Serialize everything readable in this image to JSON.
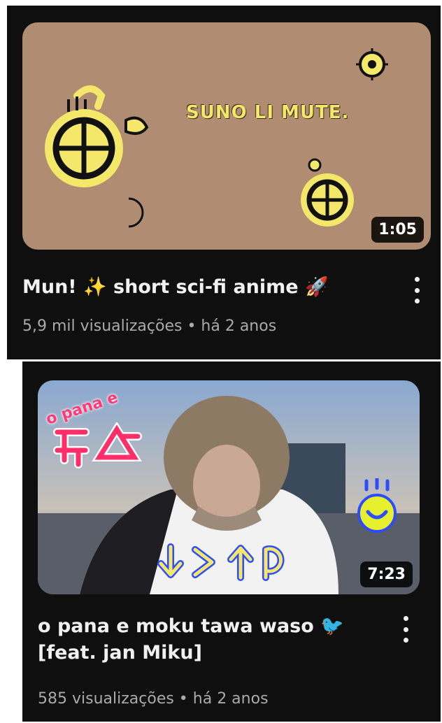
{
  "videos": [
    {
      "title": "Mun! ✨ short sci-fi anime 🚀",
      "meta": "5,9 mil visualizações • há 2 anos",
      "duration": "1:05",
      "thumb_text": "SUNO LI MUTE.",
      "menu_icon": "more-vert-icon"
    },
    {
      "title": "o pana e moku tawa waso 🐦 [feat. jan Miku]",
      "meta": "585 visualizações • há 2 anos",
      "duration": "7:23",
      "thumb_text": "o pana e",
      "menu_icon": "more-vert-icon"
    }
  ],
  "colors": {
    "background": "#0f0f0f",
    "title": "#f1f1f1",
    "meta": "#aaaaaa",
    "thumb1_bg": "#b08c72",
    "glyph_yellow": "#f4e76a"
  }
}
